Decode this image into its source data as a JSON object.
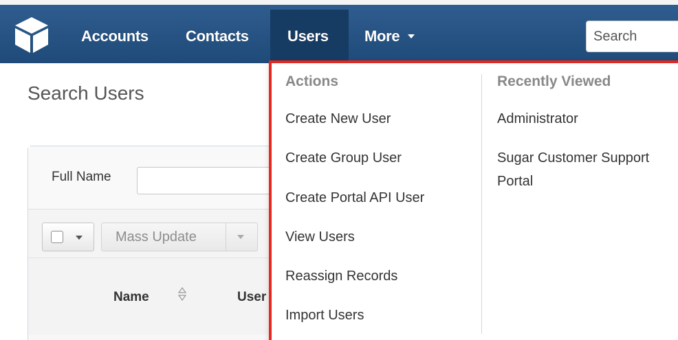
{
  "nav": {
    "logo_icon": "cube-icon",
    "items": [
      {
        "label": "Accounts"
      },
      {
        "label": "Contacts"
      },
      {
        "label": "Users"
      },
      {
        "label": "More"
      }
    ],
    "search_placeholder": "Search",
    "active_item": "Users"
  },
  "page": {
    "title": "Search Users",
    "filter": {
      "full_name_label": "Full Name",
      "full_name_value": ""
    },
    "toolbar": {
      "mass_update_label": "Mass Update"
    },
    "table": {
      "columns": [
        {
          "label": "Name"
        },
        {
          "label": "User"
        }
      ]
    }
  },
  "dropdown": {
    "actions": {
      "heading": "Actions",
      "items": [
        {
          "label": "Create New User"
        },
        {
          "label": "Create Group User"
        },
        {
          "label": "Create Portal API User"
        },
        {
          "label": "View Users"
        },
        {
          "label": "Reassign Records"
        },
        {
          "label": "Import Users"
        }
      ]
    },
    "recently_viewed": {
      "heading": "Recently Viewed",
      "items": [
        {
          "label": "Administrator"
        },
        {
          "label": "Sugar Customer Support Portal"
        }
      ]
    },
    "highlight_color": "#e8281f"
  },
  "colors": {
    "nav_bg": "#2f5d8f",
    "nav_active_bg": "#173c64"
  }
}
